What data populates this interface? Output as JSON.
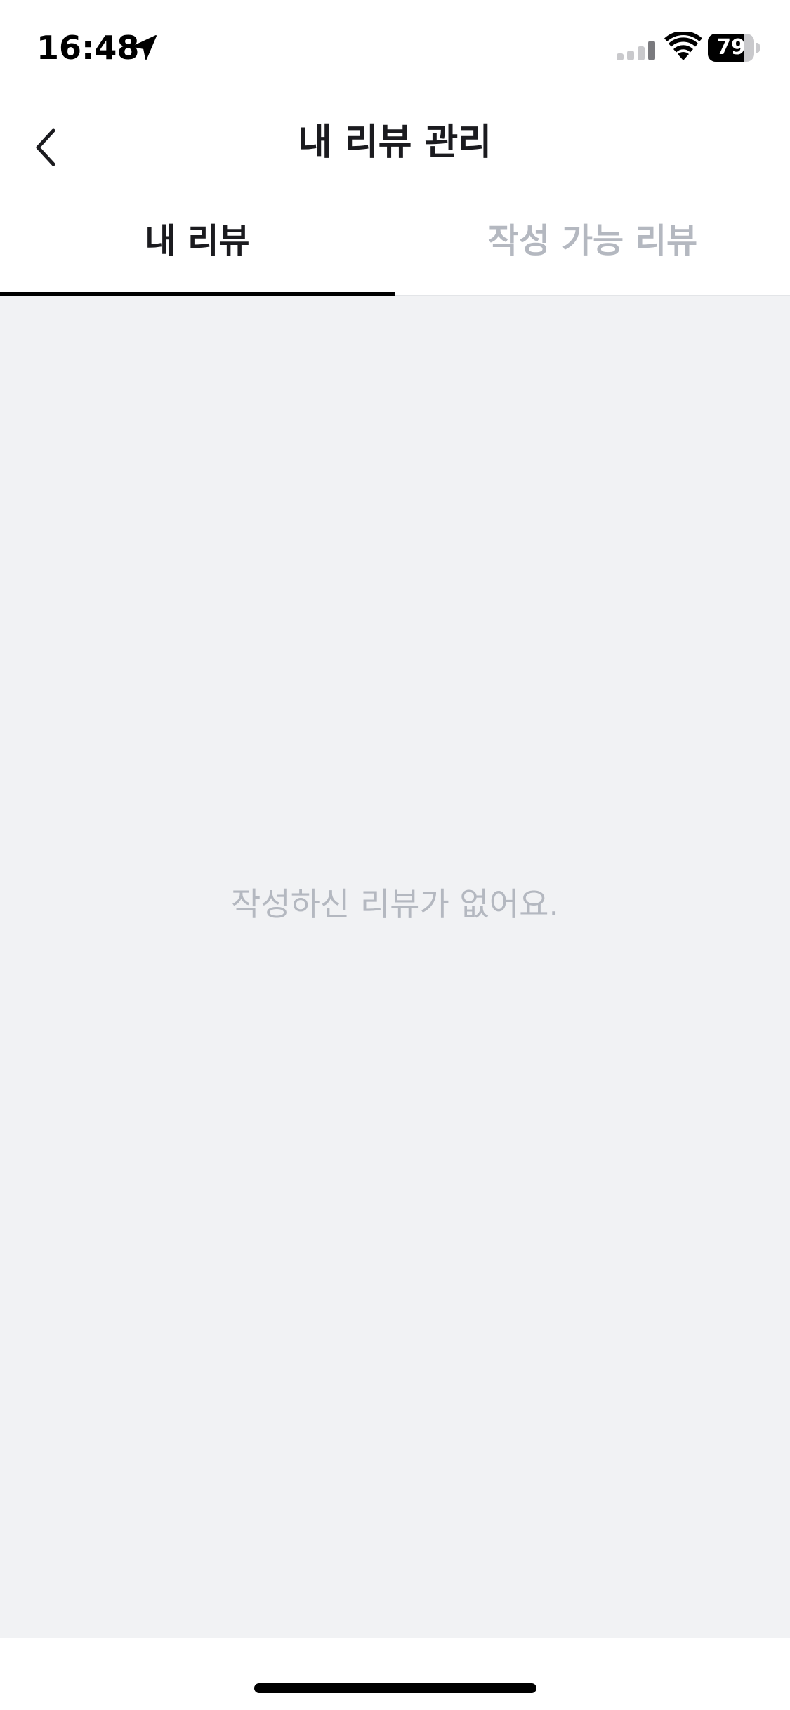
{
  "status_bar": {
    "time": "16:48",
    "battery_level": "79",
    "battery_fraction": 0.79,
    "icons": [
      "location-arrow-icon",
      "cellular-signal-icon",
      "wifi-icon",
      "battery-icon"
    ]
  },
  "header": {
    "title": "내 리뷰 관리",
    "back_icon": "chevron-left-icon"
  },
  "tabs": [
    {
      "label": "내 리뷰",
      "active": true
    },
    {
      "label": "작성 가능 리뷰",
      "active": false
    }
  ],
  "content": {
    "empty_message": "작성하신 리뷰가 없어요."
  },
  "colors": {
    "background": "#ffffff",
    "content_background": "#f1f2f4",
    "active_tab_text": "#1b1b1f",
    "inactive_tab_text": "#b4b8c0",
    "tab_indicator": "#000000",
    "empty_text": "#b4b8c0"
  }
}
